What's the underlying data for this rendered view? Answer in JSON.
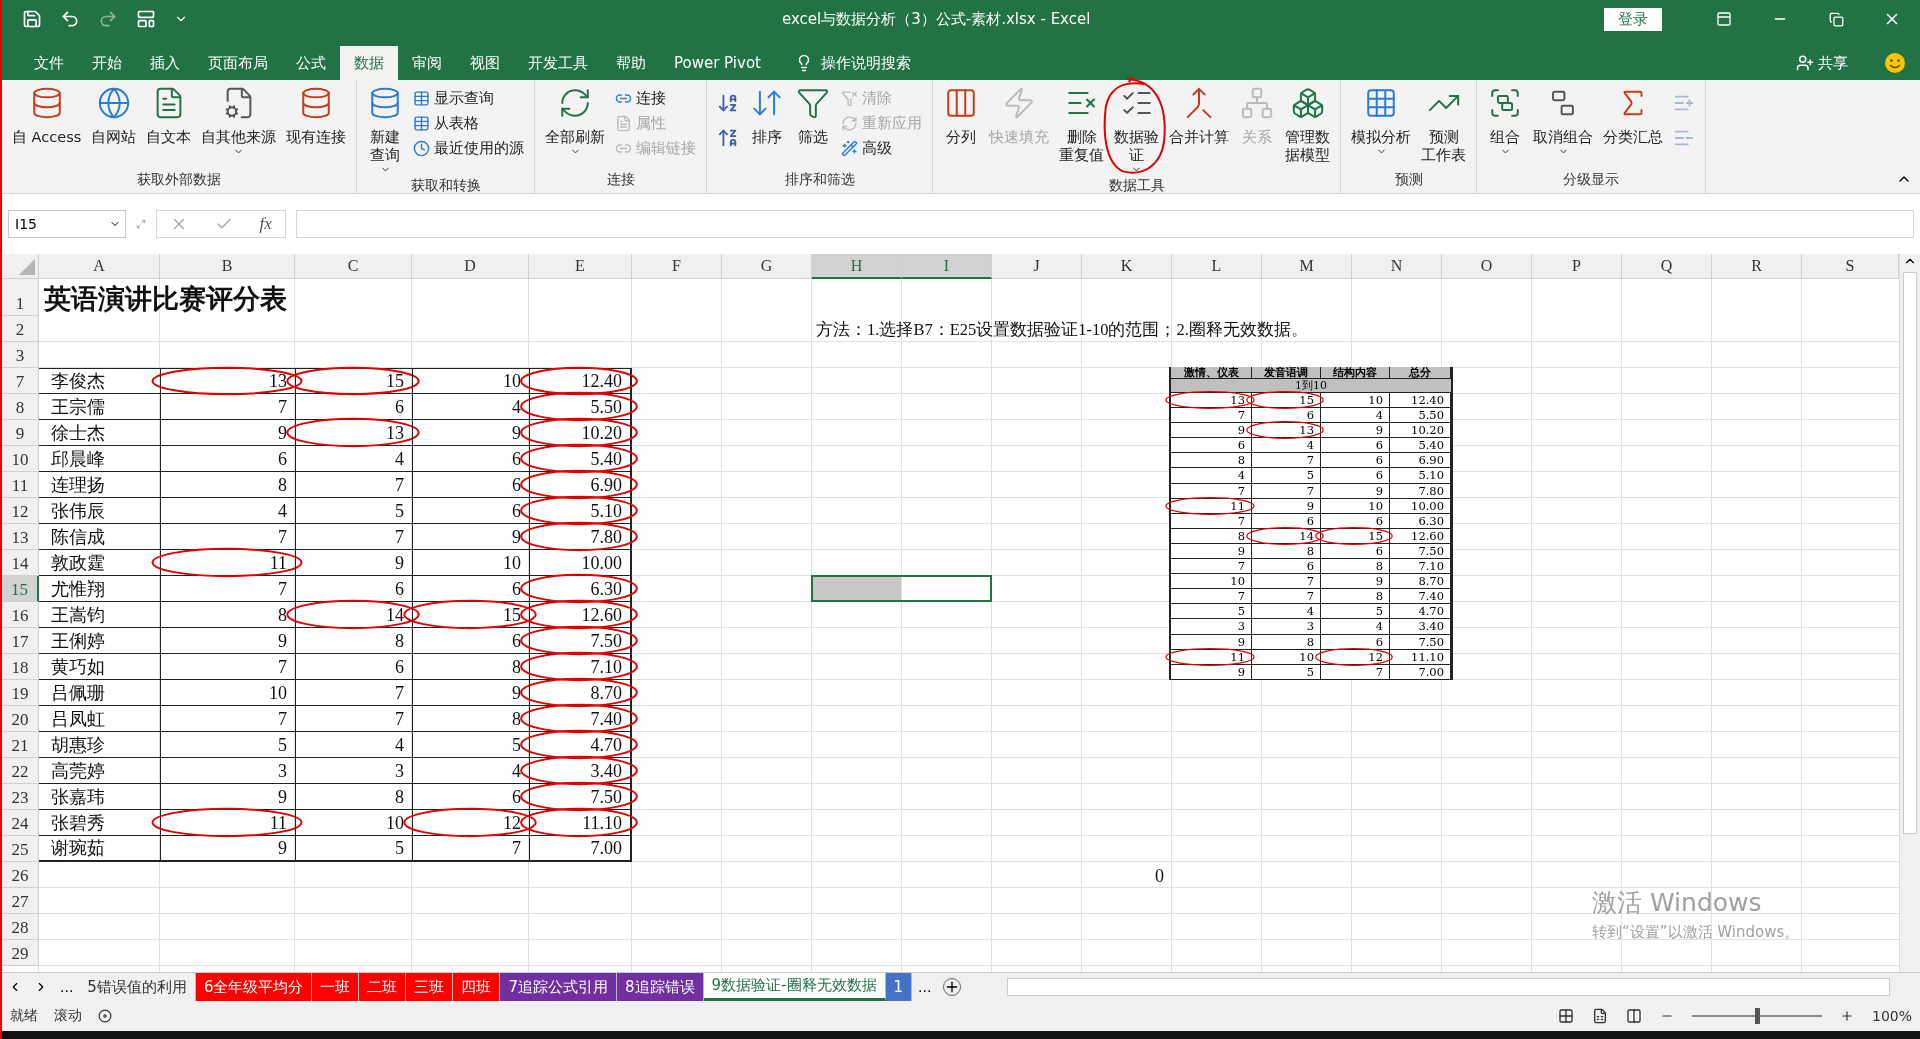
{
  "title_bar": {
    "title": "excel与数据分析（3）公式-素材.xlsx  -  Excel",
    "login": "登录"
  },
  "menu_tabs": [
    {
      "label": "文件",
      "selected": false
    },
    {
      "label": "开始",
      "selected": false
    },
    {
      "label": "插入",
      "selected": false
    },
    {
      "label": "页面布局",
      "selected": false
    },
    {
      "label": "公式",
      "selected": false
    },
    {
      "label": "数据",
      "selected": true
    },
    {
      "label": "审阅",
      "selected": false
    },
    {
      "label": "视图",
      "selected": false
    },
    {
      "label": "开发工具",
      "selected": false
    },
    {
      "label": "帮助",
      "selected": false
    },
    {
      "label": "Power Pivot",
      "selected": false
    }
  ],
  "tell_me": "操作说明搜索",
  "share": "共享",
  "ribbon_groups": [
    {
      "label": "获取外部数据",
      "commands": [
        {
          "kind": "large",
          "label": "自 Access",
          "disabled": false,
          "dropdown": false
        },
        {
          "kind": "large",
          "label": "自网站",
          "disabled": false,
          "dropdown": false
        },
        {
          "kind": "large",
          "label": "自文本",
          "disabled": false,
          "dropdown": false
        },
        {
          "kind": "large",
          "label": "自其他来源",
          "disabled": false,
          "dropdown": true
        },
        {
          "kind": "large",
          "label": "现有连接",
          "disabled": false,
          "dropdown": false
        }
      ]
    },
    {
      "label": "获取和转换",
      "commands": [
        {
          "kind": "large",
          "lines": [
            "新建",
            "查询"
          ],
          "disabled": false,
          "dropdown": true
        },
        {
          "kind": "small",
          "label": "显示查询",
          "disabled": false
        },
        {
          "kind": "small",
          "label": "从表格",
          "disabled": false
        },
        {
          "kind": "small",
          "label": "最近使用的源",
          "disabled": false
        }
      ]
    },
    {
      "label": "连接",
      "commands": [
        {
          "kind": "large",
          "label": "全部刷新",
          "disabled": false,
          "dropdown": true
        },
        {
          "kind": "small",
          "label": "连接",
          "disabled": false
        },
        {
          "kind": "small",
          "label": "属性",
          "disabled": true
        },
        {
          "kind": "small",
          "label": "编辑链接",
          "disabled": true
        }
      ]
    },
    {
      "label": "排序和筛选",
      "commands": [
        {
          "kind": "icon",
          "disabled": false
        },
        {
          "kind": "icon",
          "disabled": false
        },
        {
          "kind": "large",
          "label": "排序",
          "disabled": false,
          "dropdown": false
        },
        {
          "kind": "large",
          "label": "筛选",
          "disabled": false,
          "dropdown": false
        },
        {
          "kind": "small",
          "label": "清除",
          "disabled": true
        },
        {
          "kind": "small",
          "label": "重新应用",
          "disabled": true
        },
        {
          "kind": "small",
          "label": "高级",
          "disabled": false
        }
      ]
    },
    {
      "label": "数据工具",
      "commands": [
        {
          "kind": "large",
          "label": "分列",
          "disabled": false,
          "dropdown": false
        },
        {
          "kind": "large",
          "label": "快速填充",
          "disabled": true,
          "dropdown": false
        },
        {
          "kind": "large",
          "lines": [
            "删除",
            "重复值"
          ],
          "disabled": false,
          "dropdown": false
        },
        {
          "kind": "large",
          "lines": [
            "数据验",
            "证"
          ],
          "disabled": false,
          "dropdown": true
        },
        {
          "kind": "large",
          "label": "合并计算",
          "disabled": false,
          "dropdown": false
        },
        {
          "kind": "large",
          "label": "关系",
          "disabled": true,
          "dropdown": false
        },
        {
          "kind": "large",
          "lines": [
            "管理数",
            "据模型"
          ],
          "disabled": false,
          "dropdown": false
        }
      ]
    },
    {
      "label": "预测",
      "commands": [
        {
          "kind": "large",
          "label": "模拟分析",
          "disabled": false,
          "dropdown": true
        },
        {
          "kind": "large",
          "lines": [
            "预测",
            "工作表"
          ],
          "disabled": false,
          "dropdown": false
        }
      ]
    },
    {
      "label": "分级显示",
      "commands": [
        {
          "kind": "large",
          "label": "组合",
          "disabled": false,
          "dropdown": true
        },
        {
          "kind": "large",
          "label": "取消组合",
          "disabled": false,
          "dropdown": true
        },
        {
          "kind": "large",
          "label": "分类汇总",
          "disabled": false,
          "dropdown": false
        },
        {
          "kind": "icon",
          "disabled": true
        },
        {
          "kind": "icon",
          "disabled": true
        }
      ]
    }
  ],
  "name_box": "I15",
  "function_button": "fx",
  "columns": [
    {
      "label": "A",
      "selected": false
    },
    {
      "label": "B",
      "selected": false
    },
    {
      "label": "C",
      "selected": false
    },
    {
      "label": "D",
      "selected": false
    },
    {
      "label": "E",
      "selected": false
    },
    {
      "label": "F",
      "selected": false
    },
    {
      "label": "G",
      "selected": false
    },
    {
      "label": "H",
      "selected": true
    },
    {
      "label": "I",
      "selected": true
    },
    {
      "label": "J",
      "selected": false
    },
    {
      "label": "K",
      "selected": false
    },
    {
      "label": "L",
      "selected": false
    },
    {
      "label": "M",
      "selected": false
    },
    {
      "label": "N",
      "selected": false
    },
    {
      "label": "O",
      "selected": false
    },
    {
      "label": "P",
      "selected": false
    },
    {
      "label": "Q",
      "selected": false
    },
    {
      "label": "R",
      "selected": false
    },
    {
      "label": "S",
      "selected": false
    }
  ],
  "rows": [
    {
      "number": "1",
      "kind": "title",
      "selected": false,
      "title": "英语演讲比赛评分表"
    },
    {
      "number": "2",
      "kind": "note",
      "selected": false,
      "note": "方法：1.选择B7：E25设置数据验证1-10的范围；2.圈释无效数据。"
    },
    {
      "number": "3",
      "kind": "blank",
      "selected": false
    },
    {
      "number": "7",
      "kind": "score",
      "selected": false,
      "name": "李俊杰",
      "scores": [
        {
          "value": "13",
          "circled": true
        },
        {
          "value": "15",
          "circled": true
        },
        {
          "value": "10",
          "circled": false
        },
        {
          "value": "12.40",
          "circled": true
        }
      ]
    },
    {
      "number": "8",
      "kind": "score",
      "selected": false,
      "name": "王宗儒",
      "scores": [
        {
          "value": "7",
          "circled": false
        },
        {
          "value": "6",
          "circled": false
        },
        {
          "value": "4",
          "circled": false
        },
        {
          "value": "5.50",
          "circled": true
        }
      ]
    },
    {
      "number": "9",
      "kind": "score",
      "selected": false,
      "name": "徐士杰",
      "scores": [
        {
          "value": "9",
          "circled": false
        },
        {
          "value": "13",
          "circled": true
        },
        {
          "value": "9",
          "circled": false
        },
        {
          "value": "10.20",
          "circled": true
        }
      ]
    },
    {
      "number": "10",
      "kind": "score",
      "selected": false,
      "name": "邱晨峰",
      "scores": [
        {
          "value": "6",
          "circled": false
        },
        {
          "value": "4",
          "circled": false
        },
        {
          "value": "6",
          "circled": false
        },
        {
          "value": "5.40",
          "circled": true
        }
      ]
    },
    {
      "number": "11",
      "kind": "score",
      "selected": false,
      "name": "连理扬",
      "scores": [
        {
          "value": "8",
          "circled": false
        },
        {
          "value": "7",
          "circled": false
        },
        {
          "value": "6",
          "circled": false
        },
        {
          "value": "6.90",
          "circled": true
        }
      ]
    },
    {
      "number": "12",
      "kind": "score",
      "selected": false,
      "name": "张伟辰",
      "scores": [
        {
          "value": "4",
          "circled": false
        },
        {
          "value": "5",
          "circled": false
        },
        {
          "value": "6",
          "circled": false
        },
        {
          "value": "5.10",
          "circled": true
        }
      ]
    },
    {
      "number": "13",
      "kind": "score",
      "selected": false,
      "name": "陈信成",
      "scores": [
        {
          "value": "7",
          "circled": false
        },
        {
          "value": "7",
          "circled": false
        },
        {
          "value": "9",
          "circled": false
        },
        {
          "value": "7.80",
          "circled": true
        }
      ]
    },
    {
      "number": "14",
      "kind": "score",
      "selected": false,
      "name": "敦政霆",
      "scores": [
        {
          "value": "11",
          "circled": true
        },
        {
          "value": "9",
          "circled": false
        },
        {
          "value": "10",
          "circled": false
        },
        {
          "value": "10.00",
          "circled": false
        }
      ]
    },
    {
      "number": "15",
      "kind": "score",
      "selected": true,
      "name": "尤惟翔",
      "scores": [
        {
          "value": "7",
          "circled": false
        },
        {
          "value": "6",
          "circled": false
        },
        {
          "value": "6",
          "circled": false
        },
        {
          "value": "6.30",
          "circled": true
        }
      ]
    },
    {
      "number": "16",
      "kind": "score",
      "selected": false,
      "name": "王嵩钧",
      "scores": [
        {
          "value": "8",
          "circled": false
        },
        {
          "value": "14",
          "circled": true
        },
        {
          "value": "15",
          "circled": true
        },
        {
          "value": "12.60",
          "circled": true
        }
      ]
    },
    {
      "number": "17",
      "kind": "score",
      "selected": false,
      "name": "王俐婷",
      "scores": [
        {
          "value": "9",
          "circled": false
        },
        {
          "value": "8",
          "circled": false
        },
        {
          "value": "6",
          "circled": false
        },
        {
          "value": "7.50",
          "circled": true
        }
      ]
    },
    {
      "number": "18",
      "kind": "score",
      "selected": false,
      "name": "黄巧如",
      "scores": [
        {
          "value": "7",
          "circled": false
        },
        {
          "value": "6",
          "circled": false
        },
        {
          "value": "8",
          "circled": false
        },
        {
          "value": "7.10",
          "circled": true
        }
      ]
    },
    {
      "number": "19",
      "kind": "score",
      "selected": false,
      "name": "吕佩珊",
      "scores": [
        {
          "value": "10",
          "circled": false
        },
        {
          "value": "7",
          "circled": false
        },
        {
          "value": "9",
          "circled": false
        },
        {
          "value": "8.70",
          "circled": true
        }
      ]
    },
    {
      "number": "20",
      "kind": "score",
      "selected": false,
      "name": "吕凤虹",
      "scores": [
        {
          "value": "7",
          "circled": false
        },
        {
          "value": "7",
          "circled": false
        },
        {
          "value": "8",
          "circled": false
        },
        {
          "value": "7.40",
          "circled": true
        }
      ]
    },
    {
      "number": "21",
      "kind": "score",
      "selected": false,
      "name": "胡惠珍",
      "scores": [
        {
          "value": "5",
          "circled": false
        },
        {
          "value": "4",
          "circled": false
        },
        {
          "value": "5",
          "circled": false
        },
        {
          "value": "4.70",
          "circled": true
        }
      ]
    },
    {
      "number": "22",
      "kind": "score",
      "selected": false,
      "name": "高莞婷",
      "scores": [
        {
          "value": "3",
          "circled": false
        },
        {
          "value": "3",
          "circled": false
        },
        {
          "value": "4",
          "circled": false
        },
        {
          "value": "3.40",
          "circled": true
        }
      ]
    },
    {
      "number": "23",
      "kind": "score",
      "selected": false,
      "name": "张嘉玮",
      "scores": [
        {
          "value": "9",
          "circled": false
        },
        {
          "value": "8",
          "circled": false
        },
        {
          "value": "6",
          "circled": false
        },
        {
          "value": "7.50",
          "circled": true
        }
      ]
    },
    {
      "number": "24",
      "kind": "score",
      "selected": false,
      "name": "张碧秀",
      "scores": [
        {
          "value": "11",
          "circled": true
        },
        {
          "value": "10",
          "circled": false
        },
        {
          "value": "12",
          "circled": true
        },
        {
          "value": "11.10",
          "circled": true
        }
      ]
    },
    {
      "number": "25",
      "kind": "score",
      "selected": false,
      "name": "谢琬茹",
      "scores": [
        {
          "value": "9",
          "circled": false
        },
        {
          "value": "5",
          "circled": false
        },
        {
          "value": "7",
          "circled": false
        },
        {
          "value": "7.00",
          "circled": false
        }
      ]
    },
    {
      "number": "26",
      "kind": "value",
      "selected": false,
      "value": "0"
    },
    {
      "number": "27",
      "kind": "blank",
      "selected": false
    },
    {
      "number": "28",
      "kind": "blank",
      "selected": false
    },
    {
      "number": "29",
      "kind": "blank",
      "selected": false
    }
  ],
  "embedded_table": {
    "headers": [
      "激情、仪表",
      "发音语调",
      "结构内容",
      "总分"
    ],
    "range_label": "1到10",
    "rows": [
      [
        {
          "value": "13",
          "circled": true
        },
        {
          "value": "15",
          "circled": true
        },
        {
          "value": "10",
          "circled": false
        },
        {
          "value": "12.40",
          "circled": false
        }
      ],
      [
        {
          "value": "7",
          "circled": false
        },
        {
          "value": "6",
          "circled": false
        },
        {
          "value": "4",
          "circled": false
        },
        {
          "value": "5.50",
          "circled": false
        }
      ],
      [
        {
          "value": "9",
          "circled": false
        },
        {
          "value": "13",
          "circled": true
        },
        {
          "value": "9",
          "circled": false
        },
        {
          "value": "10.20",
          "circled": false
        }
      ],
      [
        {
          "value": "6",
          "circled": false
        },
        {
          "value": "4",
          "circled": false
        },
        {
          "value": "6",
          "circled": false
        },
        {
          "value": "5.40",
          "circled": false
        }
      ],
      [
        {
          "value": "8",
          "circled": false
        },
        {
          "value": "7",
          "circled": false
        },
        {
          "value": "6",
          "circled": false
        },
        {
          "value": "6.90",
          "circled": false
        }
      ],
      [
        {
          "value": "4",
          "circled": false
        },
        {
          "value": "5",
          "circled": false
        },
        {
          "value": "6",
          "circled": false
        },
        {
          "value": "5.10",
          "circled": false
        }
      ],
      [
        {
          "value": "7",
          "circled": false
        },
        {
          "value": "7",
          "circled": false
        },
        {
          "value": "9",
          "circled": false
        },
        {
          "value": "7.80",
          "circled": false
        }
      ],
      [
        {
          "value": "11",
          "circled": true
        },
        {
          "value": "9",
          "circled": false
        },
        {
          "value": "10",
          "circled": false
        },
        {
          "value": "10.00",
          "circled": false
        }
      ],
      [
        {
          "value": "7",
          "circled": false
        },
        {
          "value": "6",
          "circled": false
        },
        {
          "value": "6",
          "circled": false
        },
        {
          "value": "6.30",
          "circled": false
        }
      ],
      [
        {
          "value": "8",
          "circled": false
        },
        {
          "value": "14",
          "circled": true
        },
        {
          "value": "15",
          "circled": true
        },
        {
          "value": "12.60",
          "circled": false
        }
      ],
      [
        {
          "value": "9",
          "circled": false
        },
        {
          "value": "8",
          "circled": false
        },
        {
          "value": "6",
          "circled": false
        },
        {
          "value": "7.50",
          "circled": false
        }
      ],
      [
        {
          "value": "7",
          "circled": false
        },
        {
          "value": "6",
          "circled": false
        },
        {
          "value": "8",
          "circled": false
        },
        {
          "value": "7.10",
          "circled": false
        }
      ],
      [
        {
          "value": "10",
          "circled": false
        },
        {
          "value": "7",
          "circled": false
        },
        {
          "value": "9",
          "circled": false
        },
        {
          "value": "8.70",
          "circled": false
        }
      ],
      [
        {
          "value": "7",
          "circled": false
        },
        {
          "value": "7",
          "circled": false
        },
        {
          "value": "8",
          "circled": false
        },
        {
          "value": "7.40",
          "circled": false
        }
      ],
      [
        {
          "value": "5",
          "circled": false
        },
        {
          "value": "4",
          "circled": false
        },
        {
          "value": "5",
          "circled": false
        },
        {
          "value": "4.70",
          "circled": false
        }
      ],
      [
        {
          "value": "3",
          "circled": false
        },
        {
          "value": "3",
          "circled": false
        },
        {
          "value": "4",
          "circled": false
        },
        {
          "value": "3.40",
          "circled": false
        }
      ],
      [
        {
          "value": "9",
          "circled": false
        },
        {
          "value": "8",
          "circled": false
        },
        {
          "value": "6",
          "circled": false
        },
        {
          "value": "7.50",
          "circled": false
        }
      ],
      [
        {
          "value": "11",
          "circled": true
        },
        {
          "value": "10",
          "circled": false
        },
        {
          "value": "12",
          "circled": true
        },
        {
          "value": "11.10",
          "circled": false
        }
      ],
      [
        {
          "value": "9",
          "circled": false
        },
        {
          "value": "5",
          "circled": false
        },
        {
          "value": "7",
          "circled": false
        },
        {
          "value": "7.00",
          "circled": false
        }
      ]
    ]
  },
  "activation": {
    "title": "激活 Windows",
    "hint": "转到“设置”以激活 Windows。"
  },
  "sheet_tabs": {
    "leading_more": "...",
    "trailing_more": "...",
    "tabs": [
      {
        "label": "5错误值的利用",
        "selected": false
      },
      {
        "label": "6全年级平均分",
        "selected": false,
        "color": "#ff0000"
      },
      {
        "label": "一班",
        "selected": false,
        "color": "#ff0000"
      },
      {
        "label": "二班",
        "selected": false,
        "color": "#ff0000"
      },
      {
        "label": "三班",
        "selected": false,
        "color": "#ff0000"
      },
      {
        "label": "四班",
        "selected": false,
        "color": "#ff0000"
      },
      {
        "label": "7追踪公式引用",
        "selected": false,
        "color": "#7030a0"
      },
      {
        "label": "8追踪错误",
        "selected": false,
        "color": "#7030a0"
      },
      {
        "label": "9数据验证-圈释无效数据",
        "selected": true
      },
      {
        "label": "1",
        "selected": false,
        "color": "#4472c4"
      }
    ]
  },
  "status_bar": {
    "ready": "就绪",
    "scroll": "滚动",
    "zoom": "100%"
  },
  "zoom_slider": {
    "level": 0.5
  }
}
